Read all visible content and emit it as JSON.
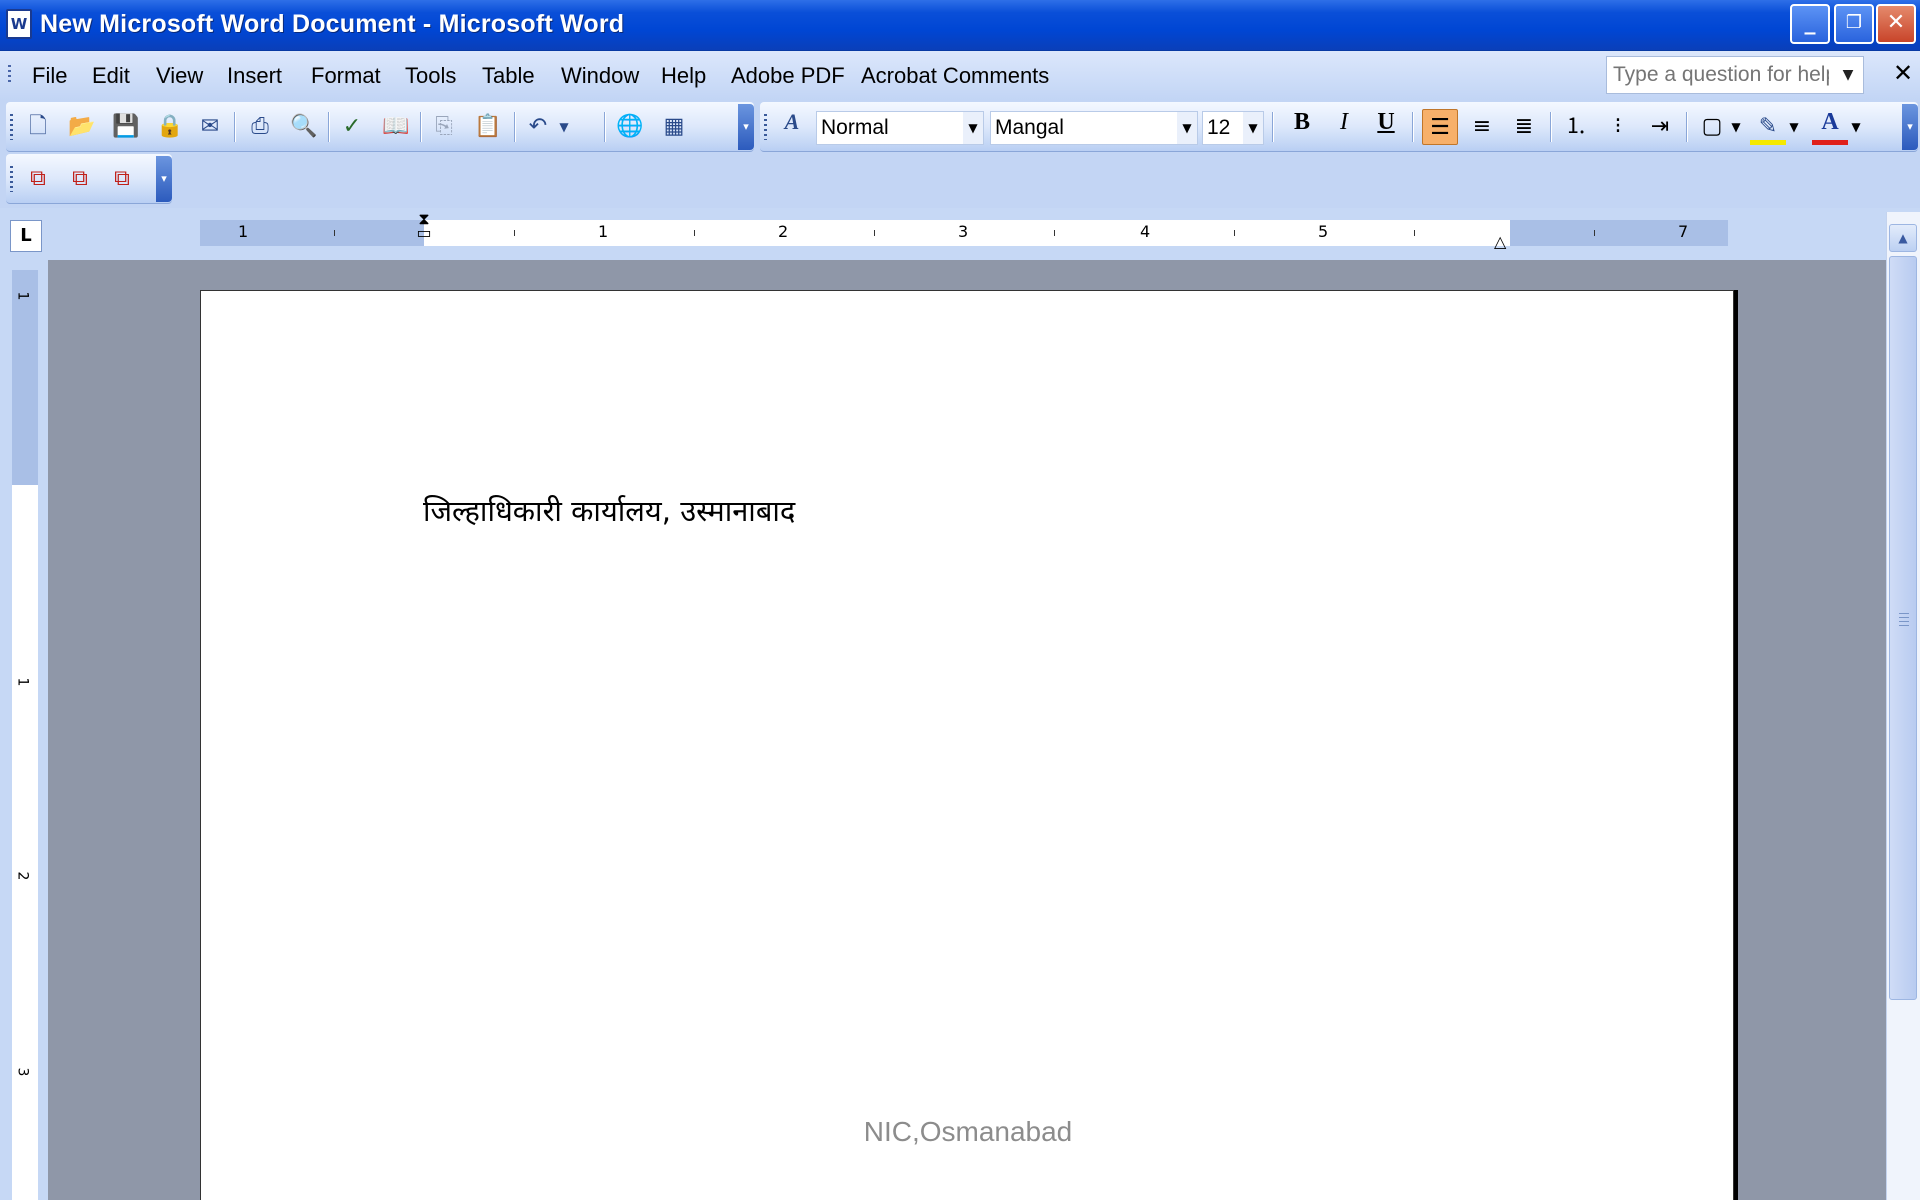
{
  "window": {
    "title": "New Microsoft Word Document - Microsoft Word",
    "app_icon": "W",
    "minimize": "_",
    "restore": "❐",
    "close": "✕"
  },
  "menu": {
    "items": [
      "File",
      "Edit",
      "View",
      "Insert",
      "Format",
      "Tools",
      "Table",
      "Window",
      "Help",
      "Adobe PDF",
      "Acrobat Comments"
    ],
    "help_placeholder": "Type a question for help",
    "close": "✕"
  },
  "toolbar": {
    "style": "Normal",
    "font": "Mangal",
    "size": "12",
    "bold": "B",
    "italic": "I",
    "underline": "U",
    "font_color_letter": "A"
  },
  "ruler": {
    "tab_selector": "L",
    "h_labels": [
      "1",
      "1",
      "2",
      "3",
      "4",
      "5",
      "7"
    ],
    "v_labels": [
      "1",
      "1",
      "2",
      "3"
    ]
  },
  "document": {
    "text": "जिल्हाधिकारी कार्यालय, उस्मानाबाद",
    "footer": "NIC,Osmanabad"
  }
}
